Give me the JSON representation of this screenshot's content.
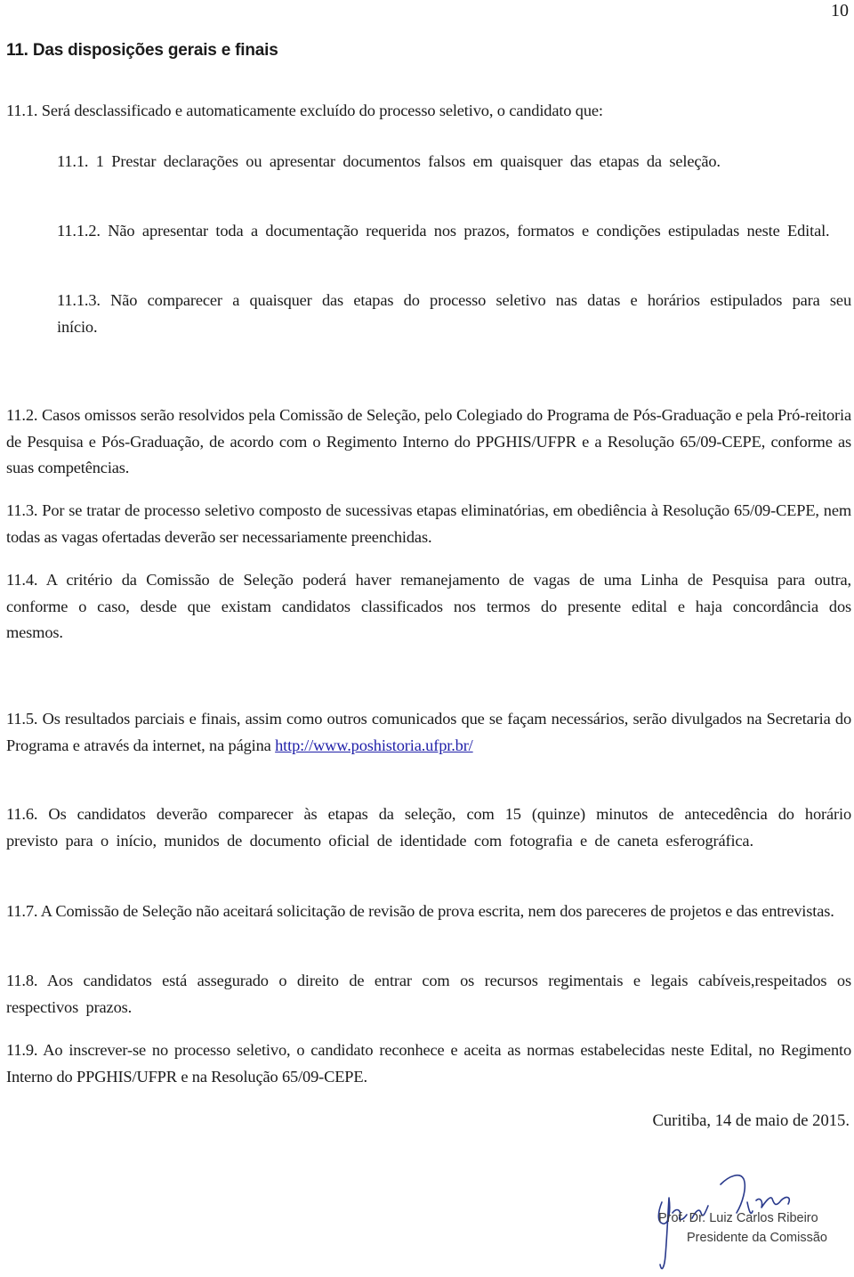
{
  "page": {
    "number": "10"
  },
  "section": {
    "title": "11. Das disposições gerais e finais"
  },
  "paragraphs": {
    "p11_1": "11.1. Será desclassificado e automaticamente excluído do processo seletivo, o candidato que:",
    "p11_1_1": "11.1. 1 Prestar declarações ou apresentar documentos falsos em quaisquer das etapas da seleção.",
    "p11_1_2": "11.1.2. Não apresentar toda a documentação requerida nos prazos, formatos e condições estipuladas neste Edital.",
    "p11_1_3": "11.1.3. Não comparecer a quaisquer das etapas do processo seletivo nas datas e horários estipulados para seu início.",
    "p11_2": "11.2. Casos omissos serão resolvidos pela Comissão de Seleção, pelo Colegiado do Programa de Pós-Graduação e pela Pró-reitoria de Pesquisa e Pós-Graduação, de acordo com o Regimento Interno do PPGHIS/UFPR e a Resolução 65/09-CEPE, conforme as suas competências.",
    "p11_3": "11.3. Por se tratar de processo seletivo composto de sucessivas etapas eliminatórias, em obediência à Resolução 65/09-CEPE, nem todas as vagas ofertadas deverão ser necessariamente preenchidas.",
    "p11_4": "11.4. A critério da Comissão de Seleção poderá haver remanejamento de vagas de uma Linha de Pesquisa para outra, conforme o caso, desde que existam candidatos classificados nos termos do presente edital e haja concordância dos mesmos.",
    "p11_5_text": "11.5. Os resultados parciais e finais, assim como outros comunicados que se façam necessários, serão divulgados na Secretaria do Programa e através da internet, na página",
    "p11_5_link": "http://www.poshistoria.ufpr.br/",
    "p11_6": "11.6. Os candidatos deverão comparecer às etapas da seleção, com 15 (quinze) minutos de antecedência do horário previsto para o início, munidos de documento oficial de identidade com fotografia e de caneta esferográfica.",
    "p11_7": "11.7. A Comissão de Seleção não aceitará solicitação de revisão de prova escrita, nem dos pareceres de projetos e das entrevistas.",
    "p11_8": "11.8. Aos candidatos está assegurado o direito de entrar com os recursos regimentais e legais cabíveis,respeitados os respectivos prazos.",
    "p11_9": "11.9. Ao inscrever-se no processo seletivo, o candidato reconhece e aceita as normas estabelecidas neste Edital, no Regimento Interno do PPGHIS/UFPR e na Resolução 65/09-CEPE."
  },
  "closing": {
    "date_line": "Curitiba, 14 de maio de 2015.",
    "signer_name": "Prof. Dr. Luiz Carlos Ribeiro",
    "signer_role": "Presidente da Comissão"
  },
  "colors": {
    "link": "#1f1fa8",
    "signature_ink": "#2a3a8c"
  }
}
